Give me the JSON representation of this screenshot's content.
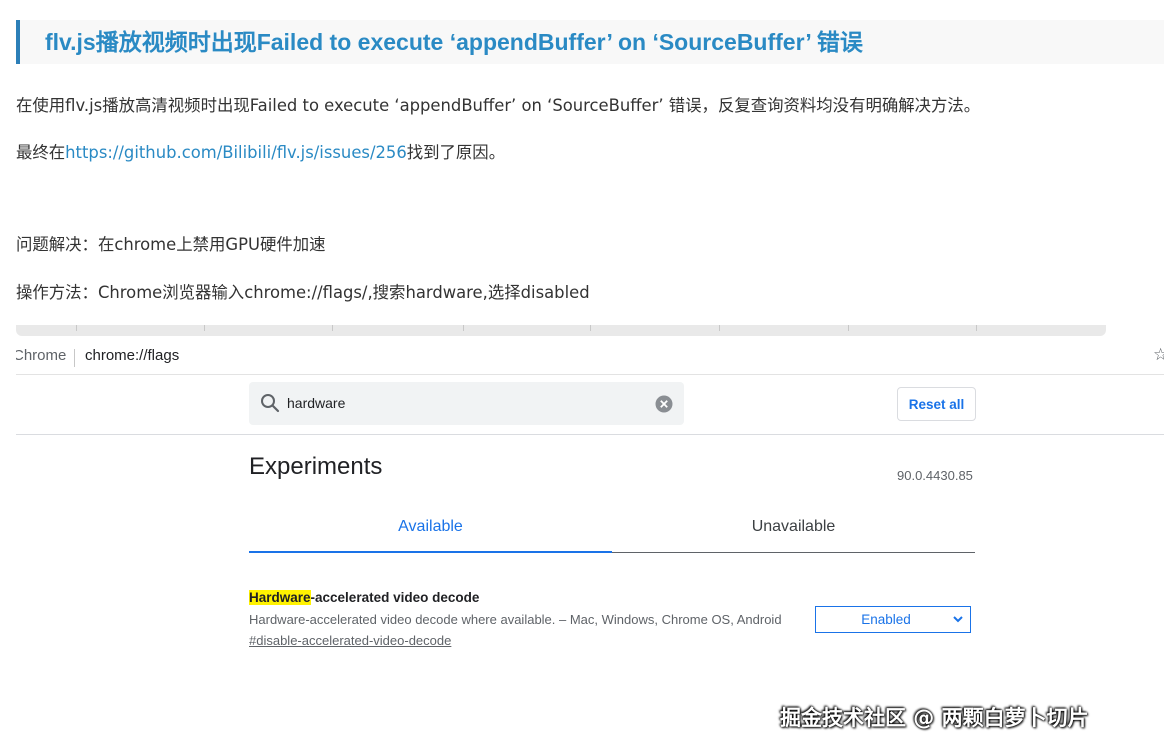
{
  "article": {
    "title": "flv.js播放视频时出现Failed to execute ‘appendBuffer’ on ‘SourceBuffer’ 错误",
    "para1": "在使用flv.js播放高清视频时出现Failed to execute ‘appendBuffer’ on ‘SourceBuffer’ 错误，反复查询资料均没有明确解决方法。",
    "para2_prefix": "最终在",
    "para2_link": "https://github.com/Bilibili/flv.js/issues/256",
    "para2_suffix": "找到了原因。",
    "para3": "问题解决：在chrome上禁用GPU硬件加速",
    "para4": "操作方法：Chrome浏览器输入chrome://flags/,搜索hardware,选择disabled"
  },
  "browser": {
    "origin_label": "Chrome",
    "url": "chrome://flags",
    "star_icon": "star-icon",
    "search": {
      "value": "hardware",
      "icon": "search-icon",
      "clear_icon": "clear-icon"
    },
    "reset_label": "Reset all",
    "page_title": "Experiments",
    "version": "90.0.4430.85",
    "tabs": [
      {
        "label": "Available",
        "active": true
      },
      {
        "label": "Unavailable",
        "active": false
      }
    ],
    "flag": {
      "title_highlight": "Hardware",
      "title_rest": "-accelerated video decode",
      "description": "Hardware-accelerated video decode where available. – Mac, Windows, Chrome OS, Android",
      "link": "#disable-accelerated-video-decode",
      "selected_option": "Enabled"
    }
  },
  "watermark": "掘金技术社区 @ 两颗白萝卜切片",
  "colors": {
    "title": "#2a8ac4",
    "link": "#2a8ac4",
    "chrome_blue": "#1a73e8",
    "highlight": "#fff200"
  }
}
